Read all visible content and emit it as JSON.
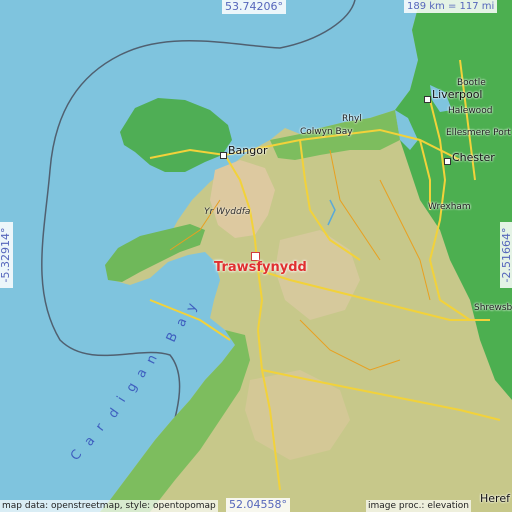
{
  "map": {
    "coords": {
      "top": "53.74206°",
      "bottom": "52.04558°",
      "left": "-5.32914°",
      "right": "-2.51664°"
    },
    "scale": "189 km = 117 mi",
    "credit_left": "map data: openstreetmap, style: opentopomap",
    "credit_right": "image proc.: elevation",
    "marker": "Trawsfynydd",
    "water_label": "Cardigan Bay",
    "peak": "Yr Wyddfa",
    "towns": {
      "bangor": "Bangor",
      "rhyl": "Rhyl",
      "colwyn_bay": "Colwyn Bay",
      "liverpool": "Liverpool",
      "bootle": "Bootle",
      "halewood": "Halewood",
      "ellesmere_port": "Ellesmere Port",
      "chester": "Chester",
      "wrexham": "Wrexham",
      "shrewsbury": "Shrewsb",
      "hereford": "Heref"
    },
    "colors": {
      "sea": "#7fc4de",
      "lowland": "#4caf50",
      "hill": "#b8c97a",
      "mountain": "#d8c89a",
      "road": "#f2d23a",
      "marker": "#e03030"
    }
  }
}
